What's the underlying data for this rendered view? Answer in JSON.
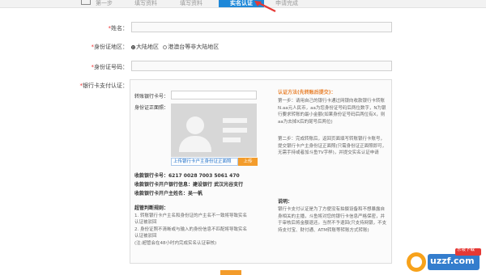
{
  "tabs": [
    {
      "label": "第一步"
    },
    {
      "label": "填写资料"
    },
    {
      "label": "填写资料"
    },
    {
      "label": "实名认证"
    },
    {
      "label": "申请完成"
    }
  ],
  "form": {
    "name_label": "姓名：",
    "region_label": "身份证地区：",
    "region_options": [
      "大陆地区",
      "港澳台等非大陆地区"
    ],
    "idnumber_label": "身份证号码：",
    "bankauth_label": "银行卡支付认证："
  },
  "panel": {
    "card_label": "转账银行卡号：",
    "photo_label": "身份证正面照：",
    "upload_link": "上传银行卡户主身份证正面照",
    "upload_button": "上传",
    "account_number": "收款银行卡号：6217 0028 7003 5061 470",
    "account_bank": "收款银行卡开户银行信息：建设银行 武汉光谷支行",
    "account_holder": "收款银行卡开户主姓名：吴一帆",
    "fail_title": "超管判断规则：",
    "fail_rule_1": "1. 转账银行卡户主名和身份证的户主名不一致将导致实名",
    "fail_rule_1b": "认证被驳回",
    "fail_rule_2": "2. 身份证照不清晰或与输入的身份信息不匹配将导致实名",
    "fail_rule_2b": "认证被驳回",
    "fail_rule_3": "(注:超管会在48小时内完成实名认证审核)",
    "method_title": "认证方法(先转账后提交)：",
    "step1": "第一步：请用自己的银行卡通过网银向收款银行卡转账N.aa元人民币，aa为您身份证号码后两位数字，N为银行要求转账的最小金额(如果身份证号码后两位有X，则aa为去掉X后的尾号后两位)",
    "step2": "第二步：完成转账后，返回页面填写转账银行卡账号，提交银行卡户主身份证正面照(只需身份证正面照即可，无需手持或者加斗鱼TV字样)，并提交实名认证申请",
    "remark_title": "说明：",
    "remark": "银行卡支付认证是为了方便没有拍摄设备和不想暴露自身相关的主播，斗鱼将对您的银行卡信息严格保密，并于审核后将金额退还。当然不予退回(只支持网银，不支持支付宝、财付通、ATM转账等转账方式转账)"
  },
  "watermark": {
    "text": "uzzf.com",
    "badge": "东坡下载"
  },
  "colors": {
    "accent": "#1e88d8",
    "orange": "#f39c2b",
    "required": "#ee3333"
  }
}
